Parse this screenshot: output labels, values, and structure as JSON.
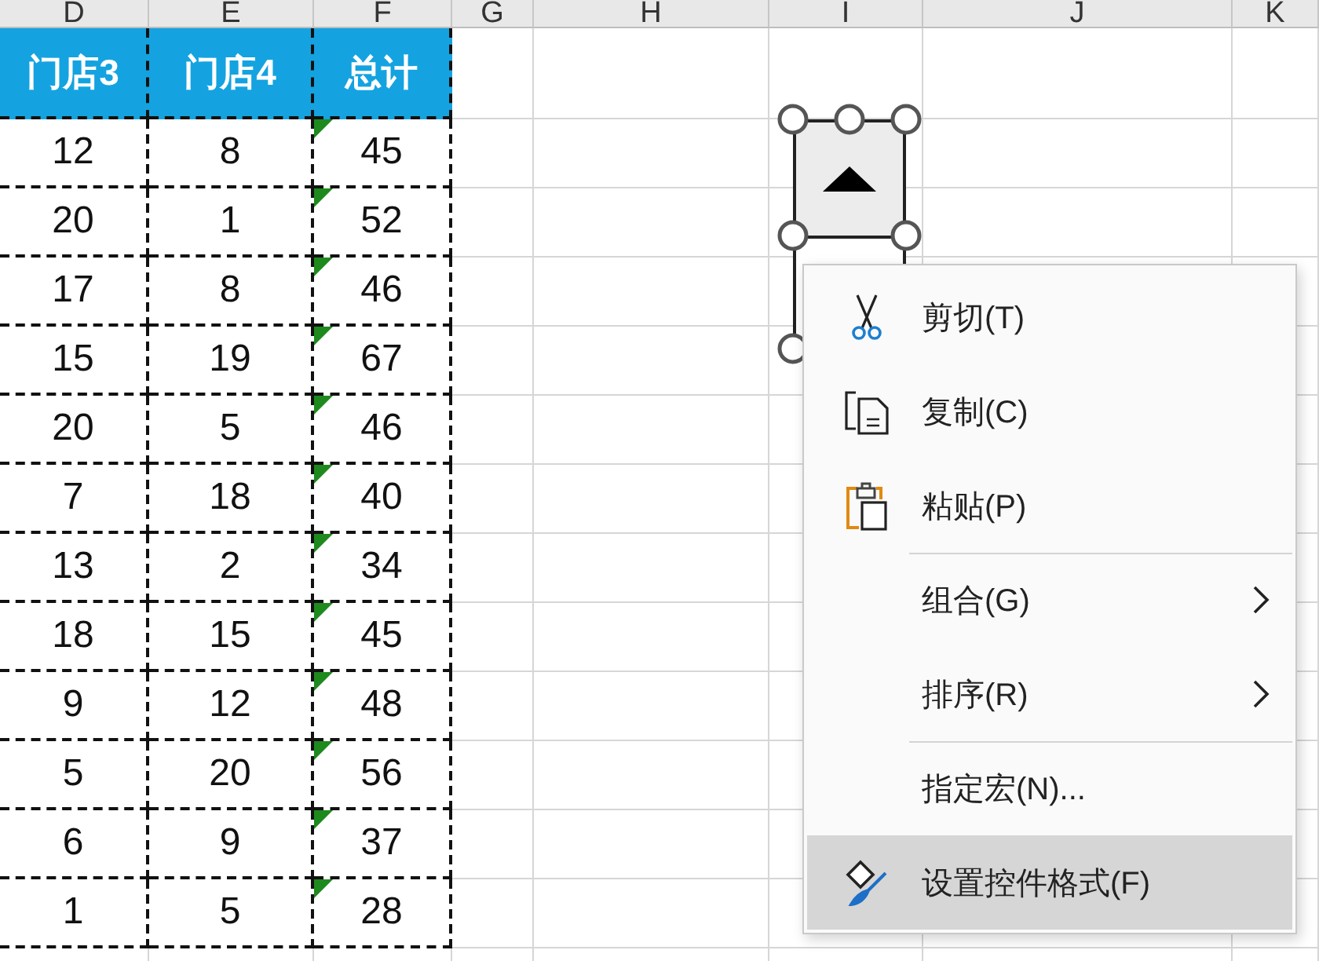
{
  "column_headers": [
    "D",
    "E",
    "F",
    "G",
    "H",
    "I",
    "J",
    "K"
  ],
  "table": {
    "columns": [
      "门店3",
      "门店4",
      "总计"
    ],
    "rows": [
      {
        "cells": [
          "12",
          "8",
          "45"
        ],
        "flagged": true
      },
      {
        "cells": [
          "20",
          "1",
          "52"
        ],
        "flagged": true
      },
      {
        "cells": [
          "17",
          "8",
          "46"
        ],
        "flagged": true
      },
      {
        "cells": [
          "15",
          "19",
          "67"
        ],
        "flagged": true
      },
      {
        "cells": [
          "20",
          "5",
          "46"
        ],
        "flagged": true
      },
      {
        "cells": [
          "7",
          "18",
          "40"
        ],
        "flagged": true
      },
      {
        "cells": [
          "13",
          "2",
          "34"
        ],
        "flagged": true
      },
      {
        "cells": [
          "18",
          "15",
          "45"
        ],
        "flagged": true
      },
      {
        "cells": [
          "9",
          "12",
          "48"
        ],
        "flagged": true
      },
      {
        "cells": [
          "5",
          "20",
          "56"
        ],
        "flagged": true
      },
      {
        "cells": [
          "6",
          "9",
          "37"
        ],
        "flagged": true
      },
      {
        "cells": [
          "1",
          "5",
          "28"
        ],
        "flagged": true
      }
    ]
  },
  "spin_button": {
    "selected": true
  },
  "context_menu": {
    "items": [
      {
        "label": "剪切(T)",
        "submenu": false,
        "separator_before": false,
        "highlighted": false
      },
      {
        "label": "复制(C)",
        "submenu": false,
        "separator_before": false,
        "highlighted": false
      },
      {
        "label": "粘贴(P)",
        "submenu": false,
        "separator_before": false,
        "highlighted": false
      },
      {
        "label": "组合(G)",
        "submenu": true,
        "separator_before": true,
        "highlighted": false
      },
      {
        "label": "排序(R)",
        "submenu": true,
        "separator_before": false,
        "highlighted": false
      },
      {
        "label": "指定宏(N)...",
        "submenu": false,
        "separator_before": true,
        "highlighted": false
      },
      {
        "label": "设置控件格式(F)",
        "submenu": false,
        "separator_before": false,
        "highlighted": true
      }
    ]
  }
}
